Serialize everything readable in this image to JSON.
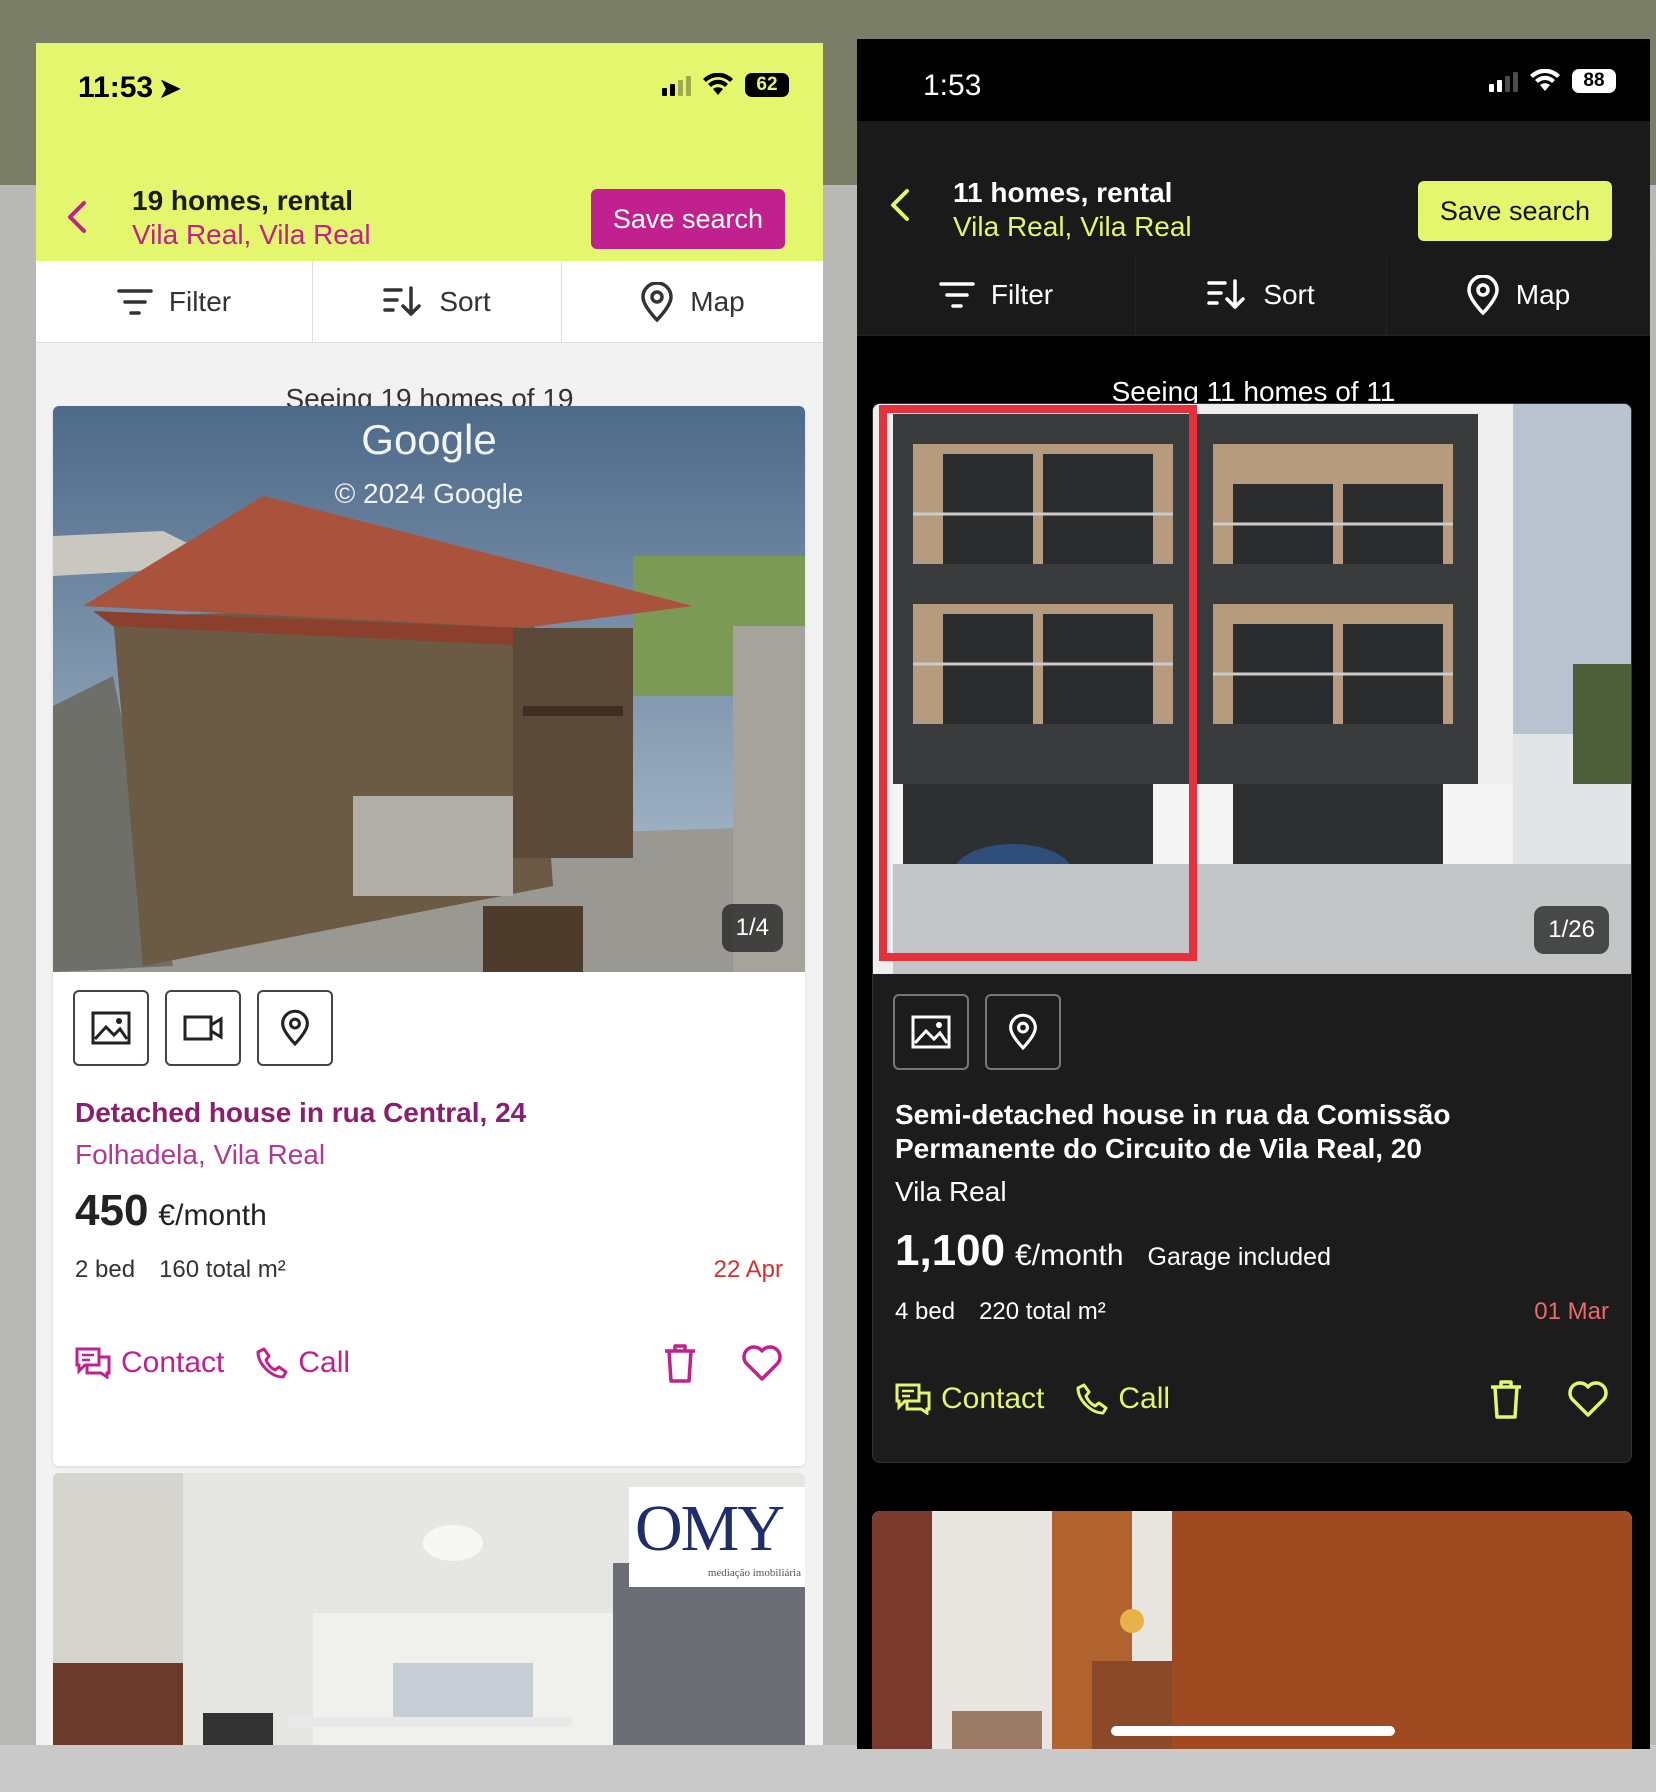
{
  "left_screen": {
    "status": {
      "time": "11:53",
      "battery": "62"
    },
    "header": {
      "title": "19 homes, rental",
      "subtitle": "Vila Real, Vila Real",
      "save_label": "Save search"
    },
    "toolbar": {
      "filter": "Filter",
      "sort": "Sort",
      "map": "Map"
    },
    "seeing": "Seeing 19 homes of 19",
    "card": {
      "photo_watermark_title": "Google",
      "photo_watermark_sub": "© 2024 Google",
      "counter": "1/4",
      "title": "Detached house in rua Central, 24",
      "location": "Folhadela, Vila Real",
      "price": "450",
      "price_unit": "€/month",
      "bed": "2 bed",
      "area": "160 total m²",
      "date": "22 Apr",
      "contact": "Contact",
      "call": "Call"
    },
    "second_card": {
      "logo": "OMY",
      "logo_sub": "mediação imobiliária"
    }
  },
  "right_screen": {
    "status": {
      "time": "1:53",
      "battery": "88"
    },
    "header": {
      "title": "11 homes, rental",
      "subtitle": "Vila Real, Vila Real",
      "save_label": "Save search"
    },
    "toolbar": {
      "filter": "Filter",
      "sort": "Sort",
      "map": "Map"
    },
    "seeing": "Seeing 11 homes of 11",
    "card": {
      "counter": "1/26",
      "title": "Semi-detached house in rua da Comissão Permanente do Circuito de Vila Real, 20",
      "location": "Vila Real",
      "price": "1,100",
      "price_unit": "€/month",
      "extra": "Garage included",
      "bed": "4 bed",
      "area": "220 total m²",
      "date": "01 Mar",
      "contact": "Contact",
      "call": "Call"
    }
  },
  "colors": {
    "brand_lime": "#e4f56e",
    "brand_magenta": "#c0218f",
    "date_red": "#d2322d",
    "highlight_red": "#e8303c"
  }
}
